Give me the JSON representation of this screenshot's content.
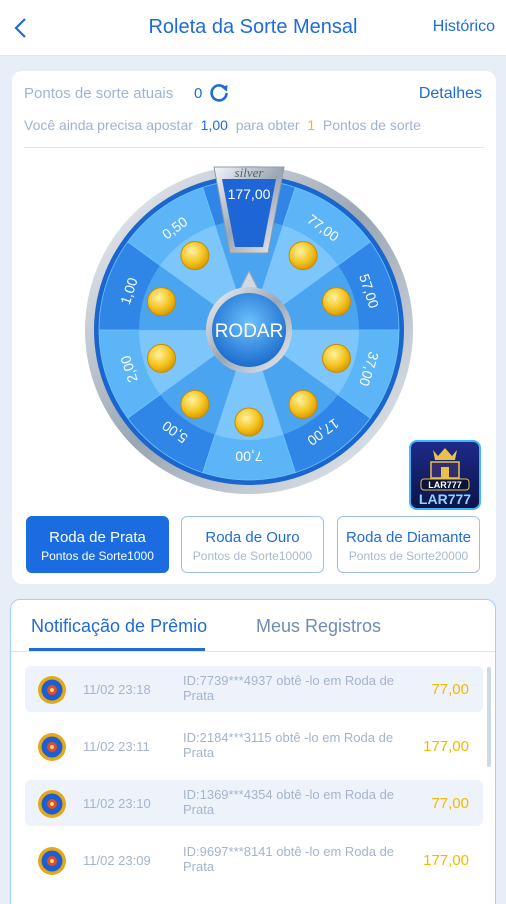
{
  "header": {
    "title": "Roleta da Sorte Mensal",
    "history_label": "Histórico"
  },
  "points": {
    "label": "Pontos de sorte atuais",
    "value": "0",
    "details_label": "Detalhes",
    "need_prefix": "Você ainda precisa apostar",
    "need_amount": "1,00",
    "need_middle": "para obter",
    "need_points": "1",
    "need_suffix": "Pontos de sorte"
  },
  "wheel": {
    "tier_label": "silver",
    "center_label": "RODAR",
    "segments": [
      "177,00",
      "77,00",
      "57,00",
      "37,00",
      "17,00",
      "7,00",
      "5,00",
      "2,00",
      "1,00",
      "0,50"
    ],
    "colors": {
      "dark": "#2f86e6",
      "light": "#5cb5f6",
      "rim": "#1b66cc"
    }
  },
  "wheel_tabs": [
    {
      "name": "Roda de Prata",
      "sub": "Pontos de Sorte1000",
      "active": true
    },
    {
      "name": "Roda de Ouro",
      "sub": "Pontos de Sorte10000",
      "active": false
    },
    {
      "name": "Roda de Diamante",
      "sub": "Pontos de Sorte20000",
      "active": false
    }
  ],
  "notifications": {
    "tab_prize": "Notificação de Prêmio",
    "tab_records": "Meus Registros",
    "rows": [
      {
        "time": "11/02 23:18",
        "desc": "ID:7739***4937 obtê -lo em Roda de Prata",
        "amount": "77,00"
      },
      {
        "time": "11/02 23:11",
        "desc": "ID:2184***3115 obtê -lo em Roda de Prata",
        "amount": "177,00"
      },
      {
        "time": "11/02 23:10",
        "desc": "ID:1369***4354 obtê -lo em Roda de Prata",
        "amount": "77,00"
      },
      {
        "time": "11/02 23:09",
        "desc": "ID:9697***8141 obtê -lo em Roda de Prata",
        "amount": "177,00"
      }
    ]
  },
  "app_logo_text": "LAR777",
  "accent_color": "#1f6bd8",
  "gold_color": "#f5b800"
}
